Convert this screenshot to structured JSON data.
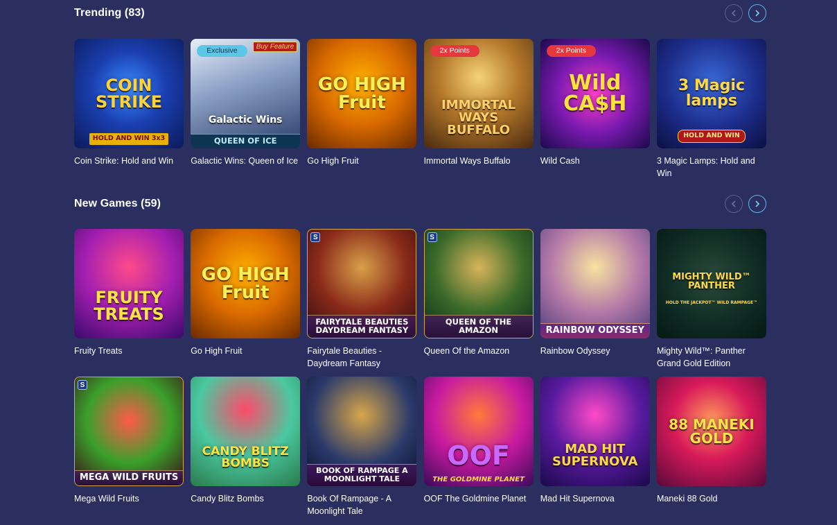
{
  "sections": [
    {
      "title": "Trending (83)",
      "games": [
        {
          "name": "Coin Strike: Hold and Win",
          "art": "COIN STRIKE",
          "sub": "HOLD AND WIN 3x3"
        },
        {
          "name": "Galactic Wins: Queen of Ice",
          "art": "Galactic Wins",
          "sub": "QUEEN OF ICE",
          "badge": "Exclusive",
          "feature": "Buy Feature"
        },
        {
          "name": "Go High Fruit",
          "art": "GO HIGH Fruit"
        },
        {
          "name": "Immortal Ways Buffalo",
          "art": "IMMORTAL WAYS BUFFALO",
          "badge": "2x Points"
        },
        {
          "name": "Wild Cash",
          "art": "Wild CA$H",
          "badge": "2x Points"
        },
        {
          "name": "3 Magic Lamps: Hold and Win",
          "art": "3 Magic lamps",
          "sub": "HOLD AND WIN"
        }
      ]
    },
    {
      "title": "New Games (59)",
      "games": [
        {
          "name": "Fruity Treats",
          "art": "FRUITY TREATS"
        },
        {
          "name": "Go High Fruit",
          "art": "GO HIGH Fruit"
        },
        {
          "name": "Fairytale Beauties - Daydream Fantasy",
          "art": "",
          "banner": "FAIRYTALE BEAUTIES DAYDREAM FANTASY",
          "logo": "S"
        },
        {
          "name": "Queen Of the Amazon",
          "art": "",
          "banner": "QUEEN OF THE AMAZON",
          "logo": "S"
        },
        {
          "name": "Rainbow Odyssey",
          "art": "",
          "banner": "RAINBOW ODYSSEY"
        },
        {
          "name": "Mighty Wild™: Panther Grand Gold Edition",
          "art": "MIGHTY WILD™ PANTHER",
          "sub": "HOLD THE JACKPOT™ WILD RAMPAGE™"
        },
        {
          "name": "Mega Wild Fruits",
          "art": "",
          "banner": "MEGA WILD FRUITS",
          "logo": "S"
        },
        {
          "name": "Candy Blitz Bombs",
          "art": "CANDY BLITZ BOMBS"
        },
        {
          "name": "Book Of Rampage - A Moonlight Tale",
          "art": "",
          "banner": "BOOK OF RAMPAGE A MOONLIGHT TALE"
        },
        {
          "name": "OOF The Goldmine Planet",
          "art": "OOF",
          "sub": "THE GOLDMINE PLANET"
        },
        {
          "name": "Mad Hit Supernova",
          "art": "MAD HIT SUPERNOVA"
        },
        {
          "name": "Maneki 88 Gold",
          "art": "88 MANEKI GOLD"
        }
      ]
    }
  ],
  "icons": {
    "prev": "chevron-left-icon",
    "next": "chevron-right-icon"
  },
  "colors": {
    "background": "#2a2f60",
    "next_button_border": "#5fb8e8",
    "points_badge": "#e5383e",
    "exclusive_badge": "#5cc6e6"
  }
}
